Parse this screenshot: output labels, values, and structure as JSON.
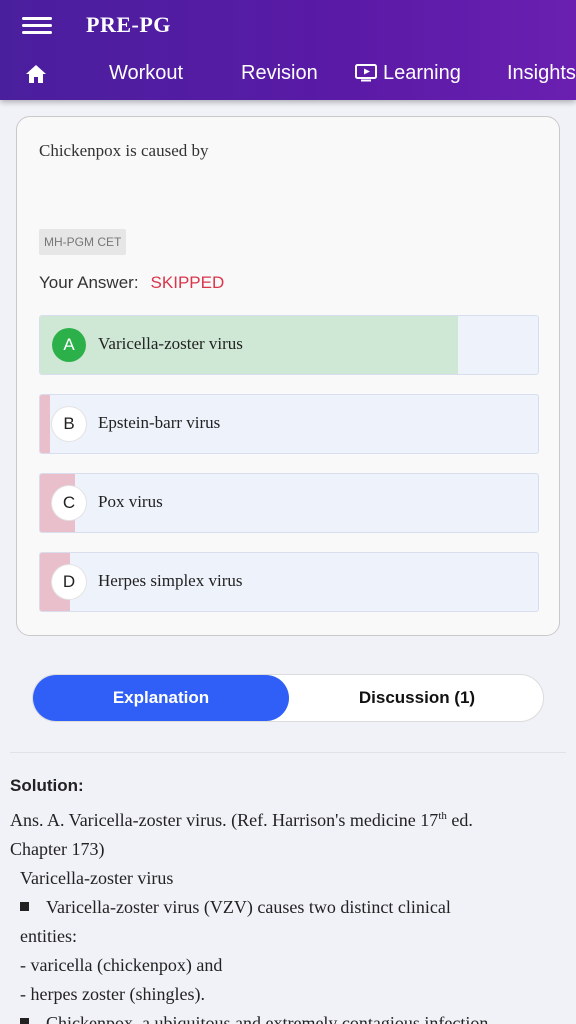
{
  "app": {
    "title": "PRE-PG"
  },
  "nav": {
    "items": [
      {
        "label": "Workout"
      },
      {
        "label": "Revision"
      },
      {
        "label": "Learning"
      },
      {
        "label": "Insights"
      }
    ]
  },
  "question": {
    "text": "Chickenpox is caused by",
    "tag": "MH-PGM CET",
    "your_answer_label": "Your Answer:",
    "your_answer_value": "SKIPPED"
  },
  "options": [
    {
      "letter": "A",
      "text": "Varicella-zoster virus",
      "correct": true,
      "percent": 84
    },
    {
      "letter": "B",
      "text": "Epstein-barr virus",
      "correct": false,
      "percent": 2
    },
    {
      "letter": "C",
      "text": "Pox virus",
      "correct": false,
      "percent": 7
    },
    {
      "letter": "D",
      "text": "Herpes simplex virus",
      "correct": false,
      "percent": 6
    }
  ],
  "tabs": {
    "explanation": "Explanation",
    "discussion": "Discussion (1)"
  },
  "solution": {
    "title": "Solution:",
    "ans_line1_pre": "Ans. A. Varicella-zoster virus. (Ref. Harrison's medicine 17",
    "ans_sup": "th",
    "ans_line1_post": " ed.",
    "ans_line2": "Chapter 173)",
    "heading": "Varicella-zoster virus",
    "bullet1": "Varicella-zoster virus (VZV) causes two distinct clinical",
    "bullet1_cont": "entities:",
    "item1": "- varicella (chickenpox) and",
    "item2": "- herpes zoster (shingles).",
    "bullet2": "Chickenpox, a ubiquitous and extremely contagious infection,"
  },
  "colors": {
    "header": "#5a1aa6",
    "correct_fill": "#cfe8d6",
    "wrong_fill": "#e8bfca",
    "correct_badge": "#2cb14a",
    "skipped": "#d9364c",
    "active_tab": "#2f5ff6"
  }
}
